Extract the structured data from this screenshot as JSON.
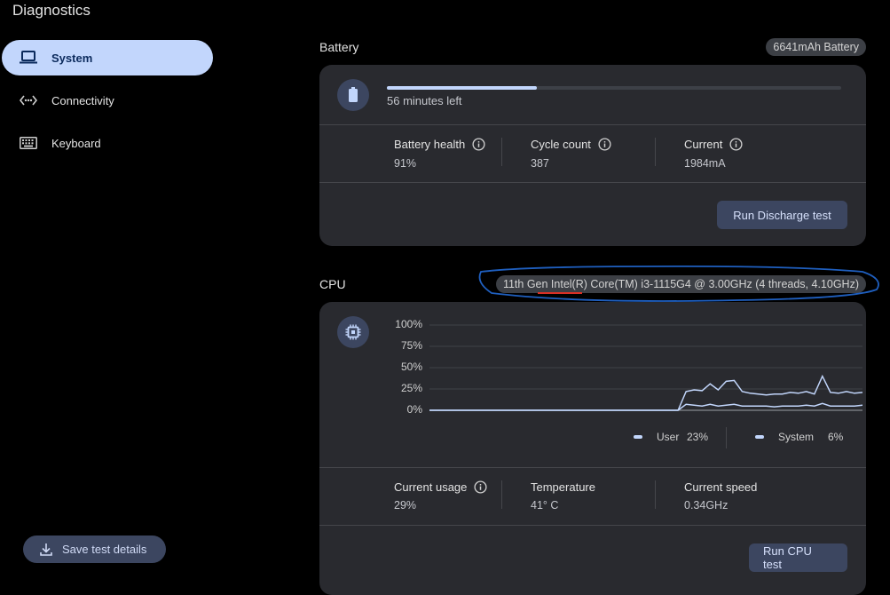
{
  "app": {
    "title": "Diagnostics"
  },
  "sidebar": {
    "items": [
      {
        "label": "System",
        "icon": "laptop-icon",
        "active": true
      },
      {
        "label": "Connectivity",
        "icon": "connectivity-icon",
        "active": false
      },
      {
        "label": "Keyboard",
        "icon": "keyboard-icon",
        "active": false
      }
    ],
    "save_label": "Save test details"
  },
  "battery": {
    "title": "Battery",
    "chip": "6641mAh Battery",
    "charge_fraction": 0.33,
    "time_left": "56 minutes left",
    "stats": [
      {
        "label": "Battery health",
        "value": "91%"
      },
      {
        "label": "Cycle count",
        "value": "387"
      },
      {
        "label": "Current",
        "value": "1984mA"
      }
    ],
    "run_label": "Run Discharge test"
  },
  "cpu": {
    "title": "CPU",
    "chip": "11th Gen Intel(R) Core(TM) i3-1115G4 @ 3.00GHz (4 threads, 4.10GHz)",
    "legend": [
      {
        "name": "User",
        "value": "23%"
      },
      {
        "name": "System",
        "value": "6%"
      }
    ],
    "stats": [
      {
        "label": "Current usage",
        "value": "29%"
      },
      {
        "label": "Temperature",
        "value": "41° C"
      },
      {
        "label": "Current speed",
        "value": "0.34GHz"
      }
    ],
    "run_label": "Run CPU test"
  },
  "colors": {
    "accent": "#c2d6fc",
    "card": "#292a2f",
    "annotation_circle": "#1f5fbf",
    "annotation_underline": "#d93025"
  },
  "chart_data": {
    "type": "line",
    "ylim": [
      0,
      100
    ],
    "y_ticks": [
      "100%",
      "75%",
      "50%",
      "25%",
      "0%"
    ],
    "x": [
      0,
      1,
      2,
      3,
      4,
      5,
      6,
      7,
      8,
      9,
      10,
      11,
      12,
      13,
      14,
      15,
      16,
      17,
      18,
      19,
      20,
      21,
      22,
      23,
      24,
      25,
      26,
      27,
      28,
      29,
      30,
      31,
      32,
      33,
      34,
      35,
      36,
      37,
      38,
      39,
      40,
      41,
      42,
      43,
      44,
      45,
      46,
      47,
      48,
      49,
      50,
      51,
      52,
      53,
      54
    ],
    "series": [
      {
        "name": "User",
        "values": [
          0,
          0,
          0,
          0,
          0,
          0,
          0,
          0,
          0,
          0,
          0,
          0,
          0,
          0,
          0,
          0,
          0,
          0,
          0,
          0,
          0,
          0,
          0,
          0,
          0,
          0,
          0,
          0,
          0,
          0,
          0,
          0,
          22,
          24,
          23,
          31,
          24,
          34,
          35,
          22,
          20,
          19,
          18,
          19,
          19,
          21,
          20,
          22,
          19,
          40,
          21,
          20,
          22,
          20,
          21
        ]
      },
      {
        "name": "System",
        "values": [
          0,
          0,
          0,
          0,
          0,
          0,
          0,
          0,
          0,
          0,
          0,
          0,
          0,
          0,
          0,
          0,
          0,
          0,
          0,
          0,
          0,
          0,
          0,
          0,
          0,
          0,
          0,
          0,
          0,
          0,
          0,
          0,
          7,
          6,
          5,
          7,
          5,
          6,
          7,
          5,
          5,
          5,
          5,
          4,
          5,
          5,
          5,
          6,
          5,
          8,
          5,
          5,
          5,
          5,
          6
        ]
      }
    ],
    "legend": "bottom-right",
    "grid": true
  }
}
